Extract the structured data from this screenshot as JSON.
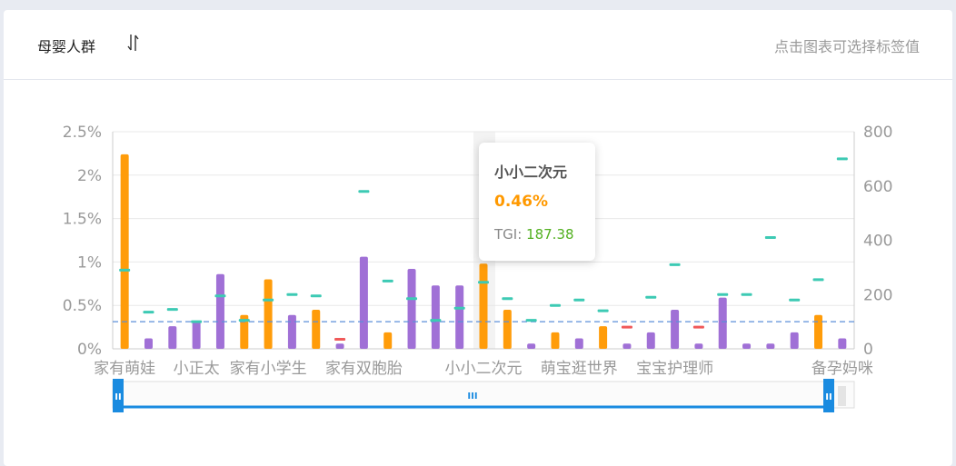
{
  "header": {
    "title": "母婴人群",
    "sort_icon": "sort-arrows-icon",
    "hint": "点击图表可选择标签值"
  },
  "tooltip": {
    "name": "小小二次元",
    "percent": "0.46%",
    "tgi_label": "TGI:",
    "tgi_value": "187.38"
  },
  "colors": {
    "orange": "#ff9c0a",
    "purple": "#a070d6",
    "tgi_high": "#3dcab4",
    "tgi_low": "#f05a5a",
    "reference_line": "#5b8fd9",
    "slider": "#1a8be0"
  },
  "chart_data": {
    "type": "bar",
    "x_tick_labels": [
      "家有萌娃",
      "小正太",
      "家有小学生",
      "家有双胞胎",
      "小小二次元",
      "萌宝逛世界",
      "宝宝护理师",
      "备孕妈咪"
    ],
    "left_axis": {
      "ticks": [
        "2.5%",
        "2%",
        "1.5%",
        "1%",
        "0.5%",
        "0%"
      ],
      "ylim": [
        0,
        2.5
      ]
    },
    "right_axis": {
      "ticks": [
        "800",
        "600",
        "400",
        "200",
        "0"
      ],
      "ylim": [
        0,
        800
      ]
    },
    "reference_tgi": 100,
    "series": [
      {
        "values": [
          2.24,
          0.12,
          0.26,
          0.32,
          0.86,
          0.39,
          0.8,
          0.39,
          0.45,
          0.06,
          1.06,
          0.19,
          0.92,
          0.73,
          0.73,
          0.98,
          0.45,
          0.06,
          0.19,
          0.12,
          0.26,
          0.06,
          0.19,
          0.45,
          0.06,
          0.59,
          0.06,
          0.06,
          0.19,
          0.39,
          0.12
        ],
        "colors": [
          "orange",
          "purple",
          "purple",
          "purple",
          "purple",
          "orange",
          "orange",
          "purple",
          "orange",
          "purple",
          "purple",
          "orange",
          "purple",
          "purple",
          "purple",
          "orange",
          "orange",
          "purple",
          "orange",
          "purple",
          "orange",
          "purple",
          "purple",
          "purple",
          "purple",
          "purple",
          "purple",
          "purple",
          "purple",
          "orange",
          "purple"
        ]
      },
      {
        "values": [
          290,
          135,
          145,
          100,
          195,
          105,
          180,
          200,
          195,
          35,
          580,
          250,
          185,
          105,
          150,
          245,
          185,
          105,
          160,
          180,
          140,
          80,
          190,
          310,
          80,
          200,
          200,
          410,
          180,
          255,
          700
        ]
      }
    ],
    "highlighted_index": 15,
    "grid": true
  }
}
